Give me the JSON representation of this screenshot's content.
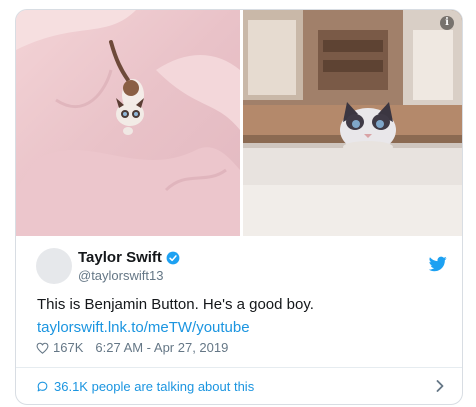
{
  "tweet": {
    "author_name": "Taylor Swift",
    "author_handle": "@taylorswift13",
    "text": "This is Benjamin Button. He's a good boy.",
    "link": "taylorswift.lnk.to/meTW/youtube",
    "likes": "167K",
    "timestamp": "6:27 AM - Apr 27, 2019",
    "conversation": "36.1K people are talking about this"
  },
  "media": {
    "info_glyph": "i",
    "photos": [
      "kitten-on-bedsheet",
      "kitten-peeking-over-table"
    ]
  },
  "icons": {
    "verified": "verified-badge-icon",
    "brand": "twitter-bird-icon",
    "like": "heart-icon",
    "reply": "speech-bubble-icon",
    "more": "chevron-right-icon"
  },
  "colors": {
    "link": "#1b95e0",
    "meta": "#657786",
    "verified": "#1da1f2",
    "border": "#d8dde3"
  }
}
